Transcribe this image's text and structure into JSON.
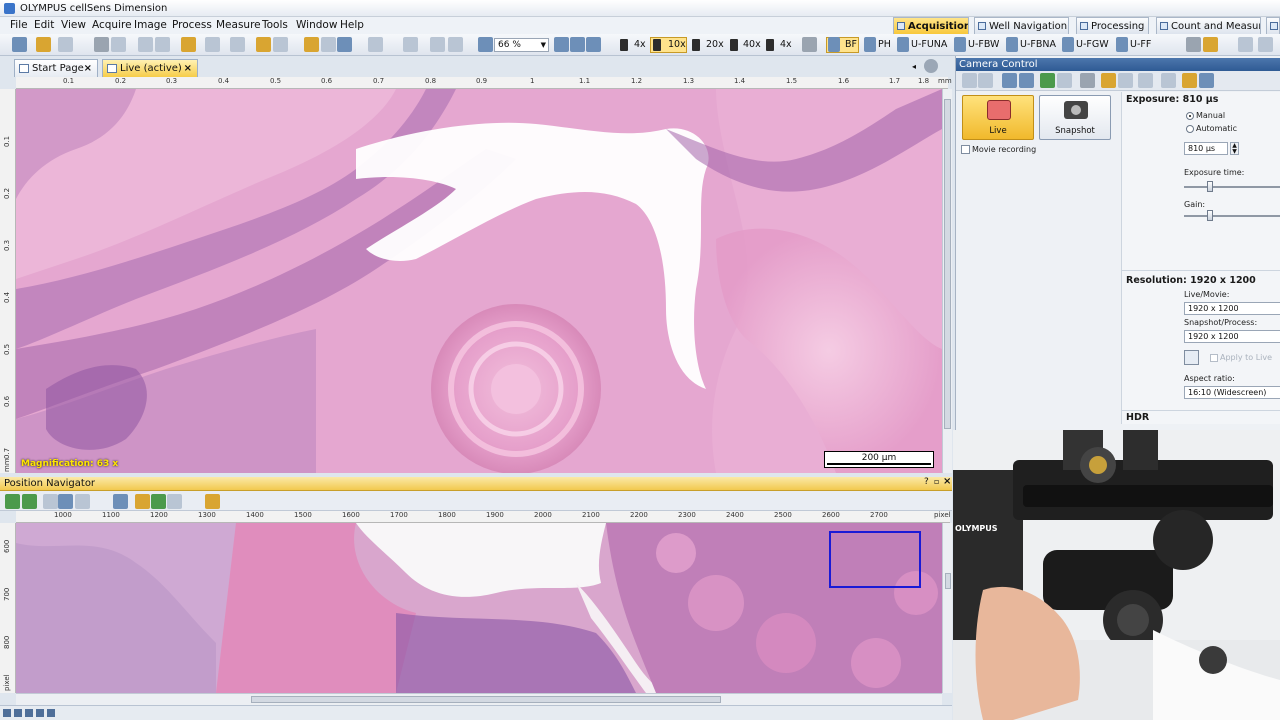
{
  "window": {
    "title": "OLYMPUS cellSens Dimension"
  },
  "menu": [
    "File",
    "Edit",
    "View",
    "Acquire",
    "Image",
    "Process",
    "Measure",
    "Tools",
    "Window",
    "Help"
  ],
  "layout_tabs": [
    {
      "label": "Acquisition",
      "active": true
    },
    {
      "label": "Well Navigation",
      "active": false
    },
    {
      "label": "Processing",
      "active": false
    },
    {
      "label": "Count and Measure",
      "active": false
    }
  ],
  "toolbar": {
    "zoom_value": "66 %",
    "objectives": [
      "4x",
      "10x",
      "20x",
      "40x",
      "4x"
    ],
    "observation": [
      "BF",
      "PH",
      "U-FUNA",
      "U-FBW",
      "U-FBNA",
      "U-FGW",
      "U-FF"
    ]
  },
  "doc_tabs": [
    {
      "label": "Start Page"
    },
    {
      "label": "Live (active)"
    }
  ],
  "top_ruler": {
    "ticks": [
      "0.1",
      "0.2",
      "0.3",
      "0.4",
      "0.5",
      "0.6",
      "0.7",
      "0.8",
      "0.9",
      "1",
      "1.1",
      "1.2",
      "1.3",
      "1.4",
      "1.5",
      "1.6",
      "1.7",
      "1.8"
    ],
    "unit": "mm"
  },
  "left_ruler": {
    "ticks": [
      "0.1",
      "0.2",
      "0.3",
      "0.4",
      "0.5",
      "0.6",
      "0.7"
    ],
    "unit": "mm"
  },
  "live_image": {
    "magnification_label": "Magnification:",
    "magnification_value": "63 x",
    "scale_label": "200 µm"
  },
  "position_navigator": {
    "title": "Position Navigator",
    "ruler_ticks": [
      "1000",
      "1100",
      "1200",
      "1300",
      "1400",
      "1500",
      "1600",
      "1700",
      "1800",
      "1900",
      "2000",
      "2100",
      "2200",
      "2300",
      "2400",
      "2500",
      "2600",
      "2700"
    ],
    "ruler_unit": "pixel",
    "left_ticks": [
      "600",
      "700",
      "800"
    ],
    "left_unit": "pixel"
  },
  "camera_control": {
    "title": "Camera Control",
    "live_label": "Live",
    "snapshot_label": "Snapshot",
    "movie_recording": "Movie recording",
    "exposure_title": "Exposure: 810 µs",
    "manual": "Manual",
    "automatic": "Automatic",
    "exposure_value": "810 µs",
    "exposure_time_label": "Exposure time:",
    "gain_label": "Gain:",
    "resolution_title": "Resolution: 1920 x 1200",
    "live_movie_label": "Live/Movie:",
    "live_movie_value": "1920 x 1200",
    "snapshot_process_label": "Snapshot/Process:",
    "snapshot_process_value": "1920 x 1200",
    "apply_to_live": "Apply to Live",
    "aspect_label": "Aspect ratio:",
    "aspect_value": "16:10 (Widescreen)",
    "hdr_title": "HDR"
  },
  "microscope_photo": {
    "brand": "OLYMPUS"
  },
  "colors": {
    "accent": "#f2c94f",
    "panel_header": "#2f5b94",
    "nav_rect": "#1a1ad6",
    "tissue_pink": "#e3a6cf",
    "tissue_purple": "#8e5aa8"
  }
}
